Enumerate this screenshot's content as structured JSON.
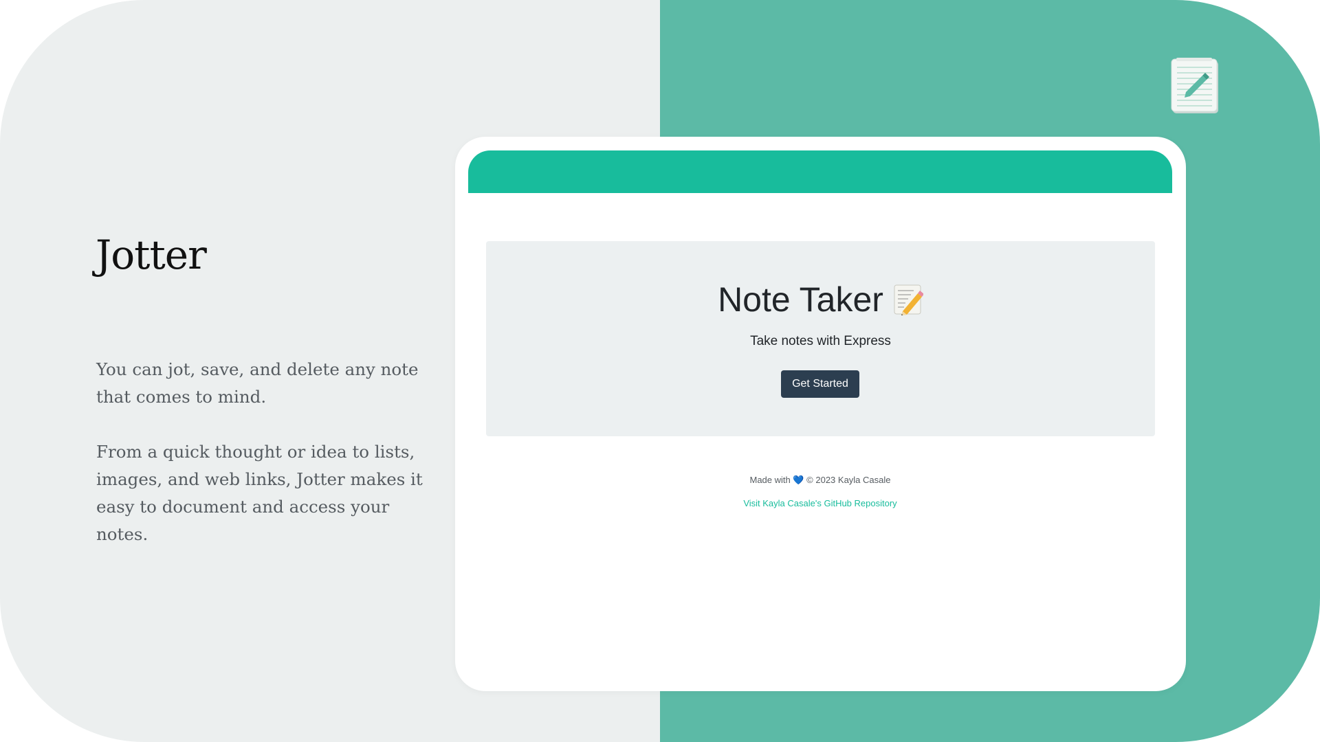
{
  "slide": {
    "title": "Jotter",
    "paragraphs": [
      "You can jot, save, and delete any note that comes to mind.",
      "From a quick thought or idea to lists, images, and web links, Jotter makes it easy to document and access your notes."
    ],
    "corner_icon": "notepad-icon",
    "colors": {
      "left_bg": "#ecefef",
      "right_bg": "#5cbaa6"
    }
  },
  "app": {
    "navbar_color": "#18bc9c",
    "jumbotron": {
      "title": "Note Taker",
      "title_icon": "memo-icon",
      "subtitle": "Take notes with Express",
      "button_label": "Get Started"
    },
    "footer": {
      "made_with": "Made with",
      "heart": "💙",
      "copyright": "© 2023 Kayla Casale",
      "repo_link": "Visit Kayla Casale's GitHub Repository"
    },
    "colors": {
      "primary": "#18bc9c",
      "button": "#2c3e50"
    }
  }
}
